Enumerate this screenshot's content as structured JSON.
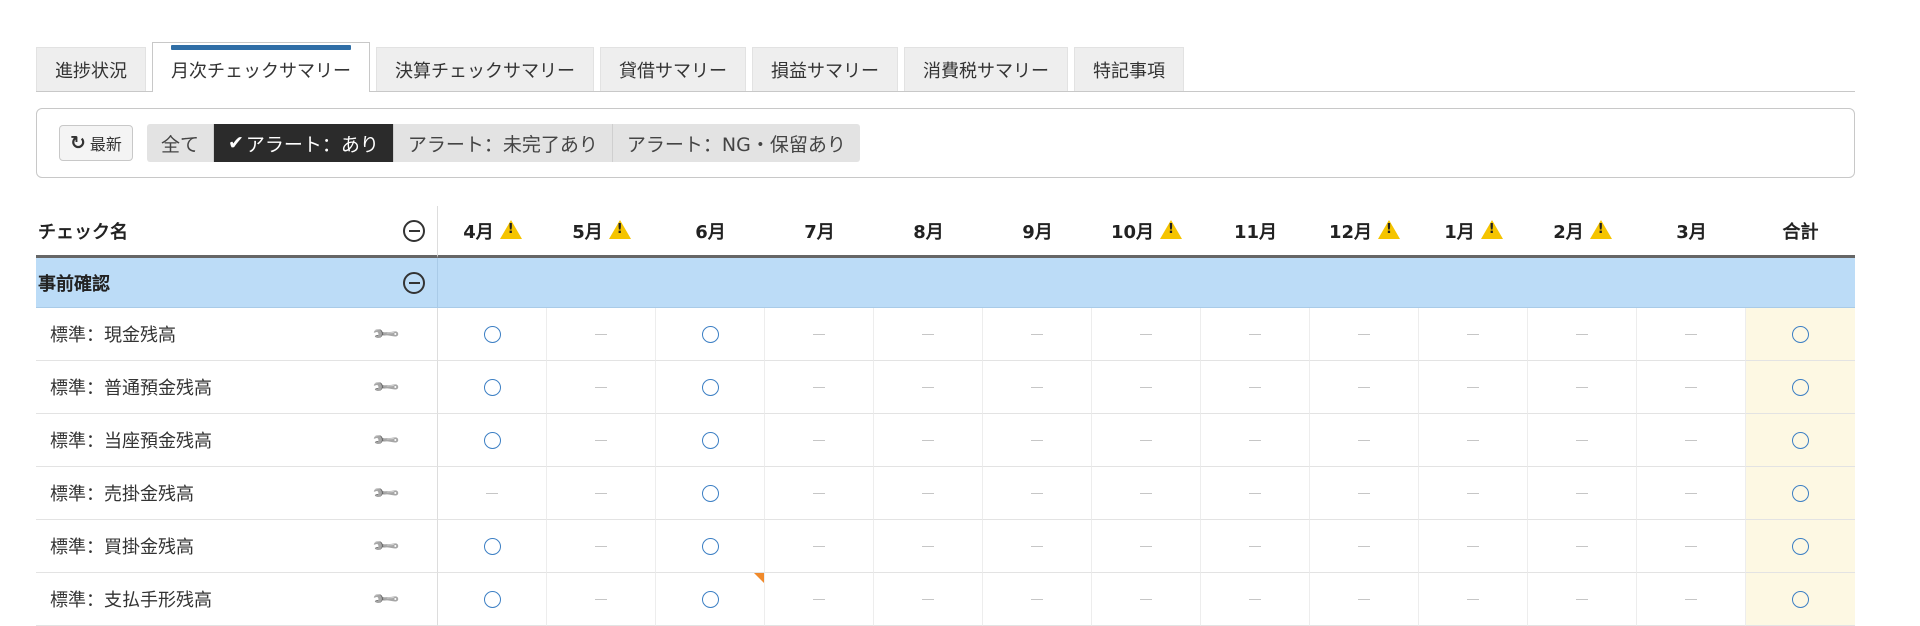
{
  "tabs": [
    {
      "label": "進捗状況",
      "active": false
    },
    {
      "label": "月次チェックサマリー",
      "active": true
    },
    {
      "label": "決算チェックサマリー",
      "active": false
    },
    {
      "label": "貸借サマリー",
      "active": false
    },
    {
      "label": "損益サマリー",
      "active": false
    },
    {
      "label": "消費税サマリー",
      "active": false
    },
    {
      "label": "特記事項",
      "active": false
    }
  ],
  "filter": {
    "refresh_label": "最新",
    "options": [
      {
        "label": "全て",
        "selected": false
      },
      {
        "label": "アラート：あり",
        "selected": true
      },
      {
        "label": "アラート：未完了あり",
        "selected": false
      },
      {
        "label": "アラート：NG・保留あり",
        "selected": false
      }
    ]
  },
  "table": {
    "name_header": "チェック名",
    "months": [
      {
        "label": "4月",
        "warn": true
      },
      {
        "label": "5月",
        "warn": true
      },
      {
        "label": "6月",
        "warn": false
      },
      {
        "label": "7月",
        "warn": false
      },
      {
        "label": "8月",
        "warn": false
      },
      {
        "label": "9月",
        "warn": false
      },
      {
        "label": "10月",
        "warn": true
      },
      {
        "label": "11月",
        "warn": false
      },
      {
        "label": "12月",
        "warn": true
      },
      {
        "label": "1月",
        "warn": true
      },
      {
        "label": "2月",
        "warn": true
      },
      {
        "label": "3月",
        "warn": false
      }
    ],
    "total_header": "合計",
    "group": {
      "name": "事前確認"
    },
    "rows": [
      {
        "name": "標準：現金残高",
        "cells": [
          "circle",
          "dash",
          "circle",
          "dash",
          "dash",
          "dash",
          "dash",
          "dash",
          "dash",
          "dash",
          "dash",
          "dash"
        ],
        "total": "circle"
      },
      {
        "name": "標準：普通預金残高",
        "cells": [
          "circle",
          "dash",
          "circle",
          "dash",
          "dash",
          "dash",
          "dash",
          "dash",
          "dash",
          "dash",
          "dash",
          "dash"
        ],
        "total": "circle"
      },
      {
        "name": "標準：当座預金残高",
        "cells": [
          "circle",
          "dash",
          "circle",
          "dash",
          "dash",
          "dash",
          "dash",
          "dash",
          "dash",
          "dash",
          "dash",
          "dash"
        ],
        "total": "circle"
      },
      {
        "name": "標準：売掛金残高",
        "cells": [
          "dash",
          "dash",
          "circle",
          "dash",
          "dash",
          "dash",
          "dash",
          "dash",
          "dash",
          "dash",
          "dash",
          "dash"
        ],
        "total": "circle"
      },
      {
        "name": "標準：買掛金残高",
        "cells": [
          "circle",
          "dash",
          "circle",
          "dash",
          "dash",
          "dash",
          "dash",
          "dash",
          "dash",
          "dash",
          "dash",
          "dash"
        ],
        "total": "circle"
      },
      {
        "name": "標準：支払手形残高",
        "cells": [
          "circle",
          "dash",
          "circle",
          "dash",
          "dash",
          "dash",
          "dash",
          "dash",
          "dash",
          "dash",
          "dash",
          "dash"
        ],
        "total": "circle",
        "note_month_index": 2
      }
    ]
  },
  "colors": {
    "accent": "#2f6ea6",
    "group_bg": "#bcdcf7",
    "total_bg": "#fdf8e3",
    "circle": "#3c7fc4",
    "warning": "#f5c400",
    "note_marker": "#f08a2c"
  }
}
